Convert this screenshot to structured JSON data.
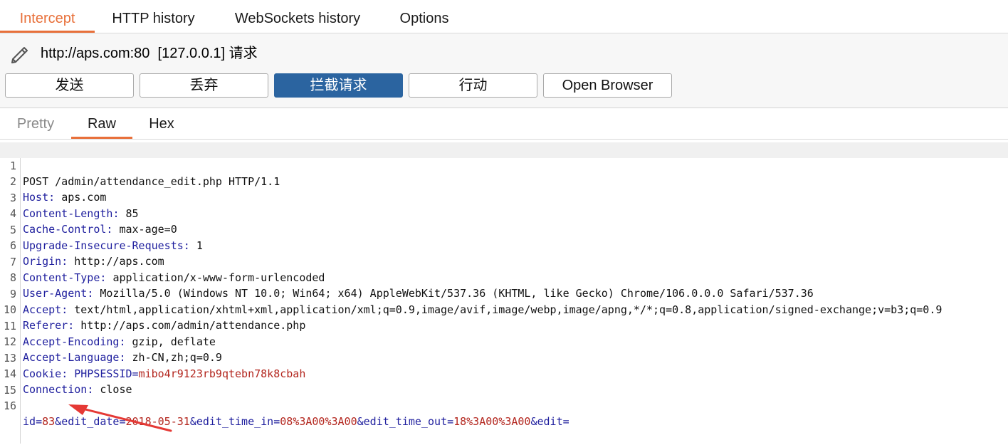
{
  "tabs": [
    {
      "label": "Intercept",
      "active": true
    },
    {
      "label": "HTTP history",
      "active": false
    },
    {
      "label": "WebSockets history",
      "active": false
    },
    {
      "label": "Options",
      "active": false
    }
  ],
  "request_target": "http://aps.com:80  [127.0.0.1] 请求",
  "buttons": {
    "forward": "发送",
    "drop": "丢弃",
    "intercept": "拦截请求",
    "action": "行动",
    "open_browser": "Open Browser"
  },
  "view_tabs": [
    {
      "label": "Pretty",
      "active": false
    },
    {
      "label": "Raw",
      "active": true
    },
    {
      "label": "Hex",
      "active": false
    }
  ],
  "request": {
    "request_line": "POST /admin/attendance_edit.php HTTP/1.1",
    "headers": [
      {
        "name": "Host",
        "value": "aps.com"
      },
      {
        "name": "Content-Length",
        "value": "85"
      },
      {
        "name": "Cache-Control",
        "value": "max-age=0"
      },
      {
        "name": "Upgrade-Insecure-Requests",
        "value": "1"
      },
      {
        "name": "Origin",
        "value": "http://aps.com"
      },
      {
        "name": "Content-Type",
        "value": "application/x-www-form-urlencoded"
      },
      {
        "name": "User-Agent",
        "value": "Mozilla/5.0 (Windows NT 10.0; Win64; x64) AppleWebKit/537.36 (KHTML, like Gecko) Chrome/106.0.0.0 Safari/537.36"
      },
      {
        "name": "Accept",
        "value": "text/html,application/xhtml+xml,application/xml;q=0.9,image/avif,image/webp,image/apng,*/*;q=0.8,application/signed-exchange;v=b3;q=0.9"
      },
      {
        "name": "Referer",
        "value": "http://aps.com/admin/attendance.php"
      },
      {
        "name": "Accept-Encoding",
        "value": "gzip, deflate"
      },
      {
        "name": "Accept-Language",
        "value": "zh-CN,zh;q=0.9"
      }
    ],
    "cookie": {
      "label": "Cookie",
      "name": "PHPSESSID",
      "value": "mibo4r9123rb9qtebn78k8cbah"
    },
    "connection": {
      "name": "Connection",
      "value": "close"
    },
    "body_params": [
      {
        "key": "id",
        "value": "83"
      },
      {
        "key": "edit_date",
        "value": "2018-05-31"
      },
      {
        "key": "edit_time_in",
        "value": "08%3A00%3A00"
      },
      {
        "key": "edit_time_out",
        "value": "18%3A00%3A00"
      },
      {
        "key": "edit",
        "value": ""
      }
    ]
  },
  "line_numbers": [
    "1",
    "2",
    "3",
    "4",
    "5",
    "6",
    "7",
    "8",
    "9",
    "10",
    "11",
    "12",
    "13",
    "14",
    "15",
    "16"
  ],
  "colors": {
    "accent": "#e8703a",
    "primary_button": "#2b64a0",
    "header_key": "#1f1f9e",
    "param_value": "#b3261e",
    "annotation_arrow": "#e53935"
  },
  "annotation": {
    "icon": "red-arrow-icon"
  }
}
